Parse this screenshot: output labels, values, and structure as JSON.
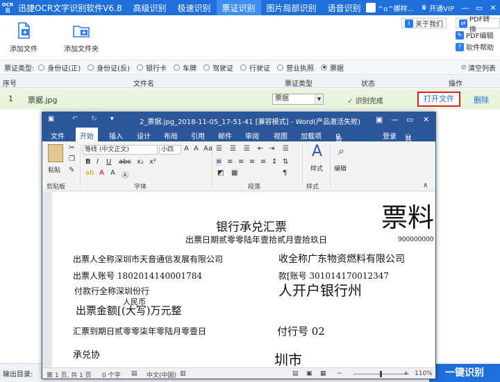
{
  "app": {
    "logo_top": "OCR",
    "logo_bottom": "迅",
    "title": "迅捷OCR文字识别软件V6.8",
    "nav": [
      {
        "label": "高级识别"
      },
      {
        "label": "极速识别"
      },
      {
        "label": "票证识别"
      },
      {
        "label": "图片局部识别"
      },
      {
        "label": "语音识别"
      }
    ],
    "account": "^o^娜样...",
    "vip": "开通VIP"
  },
  "toolbar": {
    "add_file": "添加文件",
    "add_folder": "添加文件夹",
    "about": "关于我们",
    "pdf_convert": "PDF转换",
    "pdf_edit": "PDF编辑",
    "help": "软件帮助"
  },
  "filter": {
    "label": "票证类型:",
    "options": [
      "身份证(正)",
      "身份证(反)",
      "银行卡",
      "车牌",
      "驾驶证",
      "行驶证",
      "营业执照",
      "票据"
    ],
    "selected": "票据",
    "clear": "清空列表"
  },
  "table": {
    "headers": {
      "index": "序号",
      "filename": "文件名",
      "type": "票证类型",
      "status": "状态",
      "action": "操作"
    },
    "rows": [
      {
        "index": "1",
        "filename": "票据.jpg",
        "type": "票据",
        "status": "识别完成",
        "open": "打开文件",
        "delete": "删除"
      }
    ]
  },
  "bottom": {
    "output_label": "输出目录:",
    "recognize": "一键识别"
  },
  "word": {
    "title": "2_票据.jpg_2018-11-05_17-51-41 [兼容模式] - Word(产品激活失败)",
    "tabs": [
      "文件",
      "开始",
      "插入",
      "设计",
      "布局",
      "引用",
      "邮件",
      "审阅",
      "视图",
      "加载项"
    ],
    "active_tab": "开始",
    "tell_me": "告诉我...",
    "login": "登录",
    "share": "共享",
    "ribbon": {
      "paste": "粘贴",
      "clipboard": "剪贴板",
      "font_name": "等线 (中文正文)",
      "font_size": "小四",
      "font_group": "字体",
      "paragraph_group": "段落",
      "styles": "样式",
      "styles_group": "样式",
      "edit": "编辑"
    },
    "doc": {
      "big_title": "票料",
      "heading": "银行承兑汇票",
      "date_line": "出票日期贰零零陆年壹拾贰月壹拾玖日",
      "serial": "900000000",
      "lines": [
        "出票人全称深圳市天音通信发展有限公司",
        "收全称广东物资燃料有限公司",
        "出票人账号 1802014140001784",
        "款[账号 301014170012347",
        "付款行全称深圳份行",
        "人开户银行州",
        "人民币",
        "出票金额[(大写)万元整",
        "汇票到期日贰零零柒年零陆月零壹日",
        "付行号 02",
        "承兑协",
        "圳市"
      ]
    },
    "status": {
      "page": "第 1 页, 共 1 页",
      "words": "0 个字",
      "lang": "中文(中国)",
      "zoom": "110%"
    }
  }
}
